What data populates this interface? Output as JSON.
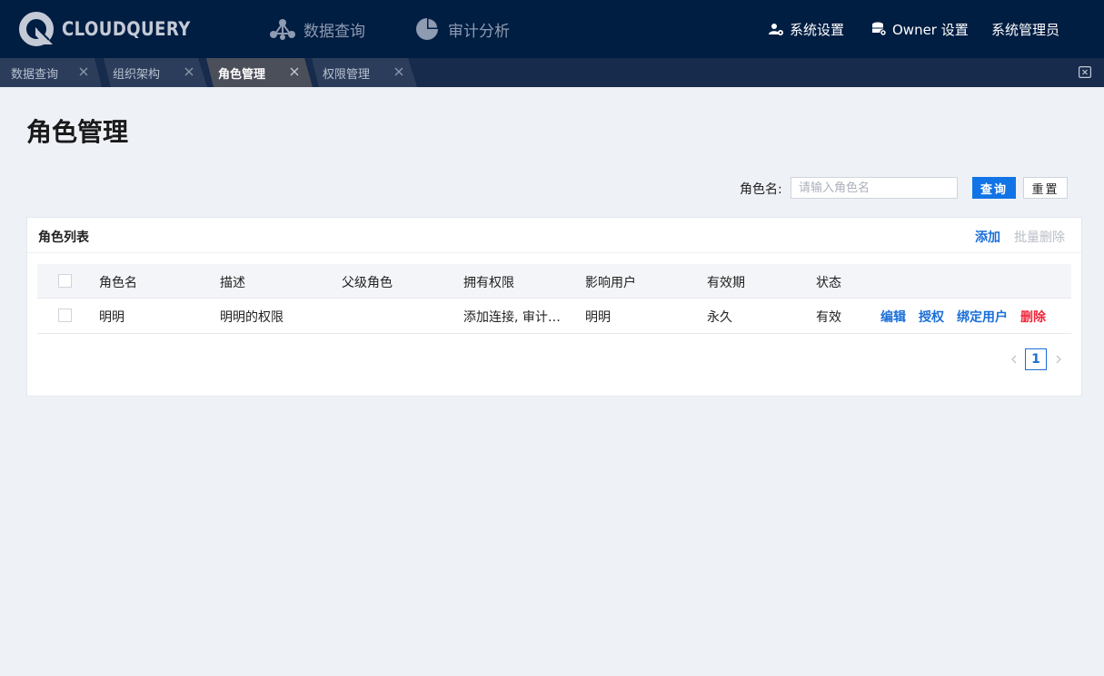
{
  "app": {
    "logo_text": "CLOUDQUERY"
  },
  "main_nav": [
    {
      "label": "数据查询",
      "icon": "graph-nodes-icon"
    },
    {
      "label": "审计分析",
      "icon": "pie-chart-icon"
    }
  ],
  "right_menu": {
    "system_settings": "系统设置",
    "owner_settings": "Owner 设置",
    "user": "系统管理员"
  },
  "tabs": [
    {
      "label": "数据查询",
      "active": false
    },
    {
      "label": "组织架构",
      "active": false
    },
    {
      "label": "角色管理",
      "active": true
    },
    {
      "label": "权限管理",
      "active": false
    }
  ],
  "page": {
    "title": "角色管理"
  },
  "search": {
    "label": "角色名:",
    "placeholder": "请输入角色名",
    "value": "",
    "query_button": "查询",
    "reset_button": "重置"
  },
  "card": {
    "title": "角色列表",
    "add": "添加",
    "batch_delete": "批量删除"
  },
  "table": {
    "columns": [
      "角色名",
      "描述",
      "父级角色",
      "拥有权限",
      "影响用户",
      "有效期",
      "状态"
    ],
    "rows": [
      {
        "name": "明明",
        "description": "明明的权限",
        "parent": "",
        "permissions": "添加连接, 审计…",
        "users": "明明",
        "validity": "永久",
        "status": "有效",
        "actions": {
          "edit": "编辑",
          "authorize": "授权",
          "bind_users": "绑定用户",
          "delete": "删除"
        }
      }
    ]
  },
  "pagination": {
    "current_page": "1"
  },
  "colors": {
    "topbar": "#001d42",
    "tabbar": "#172b4d",
    "active_tab": "#4b4f5a",
    "primary": "#1174e6",
    "link": "#1a6fd8",
    "danger": "#f0263a",
    "background": "#eef1f6"
  }
}
